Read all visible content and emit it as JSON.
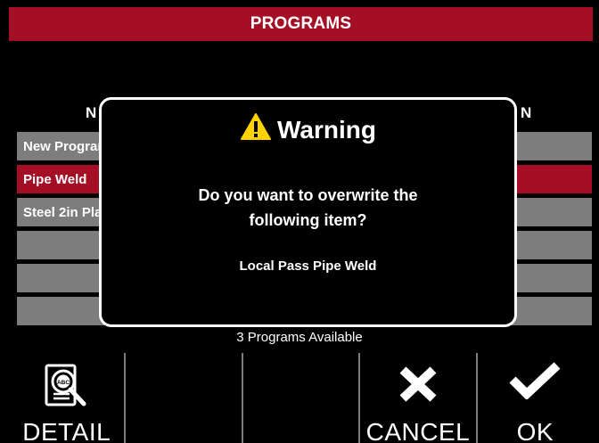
{
  "screen": {
    "title": "PROGRAMS"
  },
  "table": {
    "header_left": "N",
    "header_right": "N",
    "rows": [
      {
        "label": "New Program"
      },
      {
        "label": "Pipe Weld"
      },
      {
        "label": "Steel 2in Plate"
      },
      {
        "label": ""
      },
      {
        "label": ""
      },
      {
        "label": ""
      }
    ],
    "selected_index": 1
  },
  "status": {
    "text": "3 Programs Available"
  },
  "footer": {
    "buttons": [
      {
        "label": "DETAIL",
        "icon": "detail-magnifier-icon"
      },
      {
        "label": "",
        "icon": ""
      },
      {
        "label": "",
        "icon": ""
      },
      {
        "label": "CANCEL",
        "icon": "x-icon"
      },
      {
        "label": "OK",
        "icon": "checkmark-icon"
      }
    ]
  },
  "dialog": {
    "title": "Warning",
    "icon": "warning-icon",
    "message_line1": "Do you want to overwrite the",
    "message_line2": "following item?",
    "item": "Local Pass Pipe Weld"
  },
  "colors": {
    "accent": "#a50f26",
    "row_bg": "#7d7d7d",
    "warning_yellow": "#ffd200"
  }
}
